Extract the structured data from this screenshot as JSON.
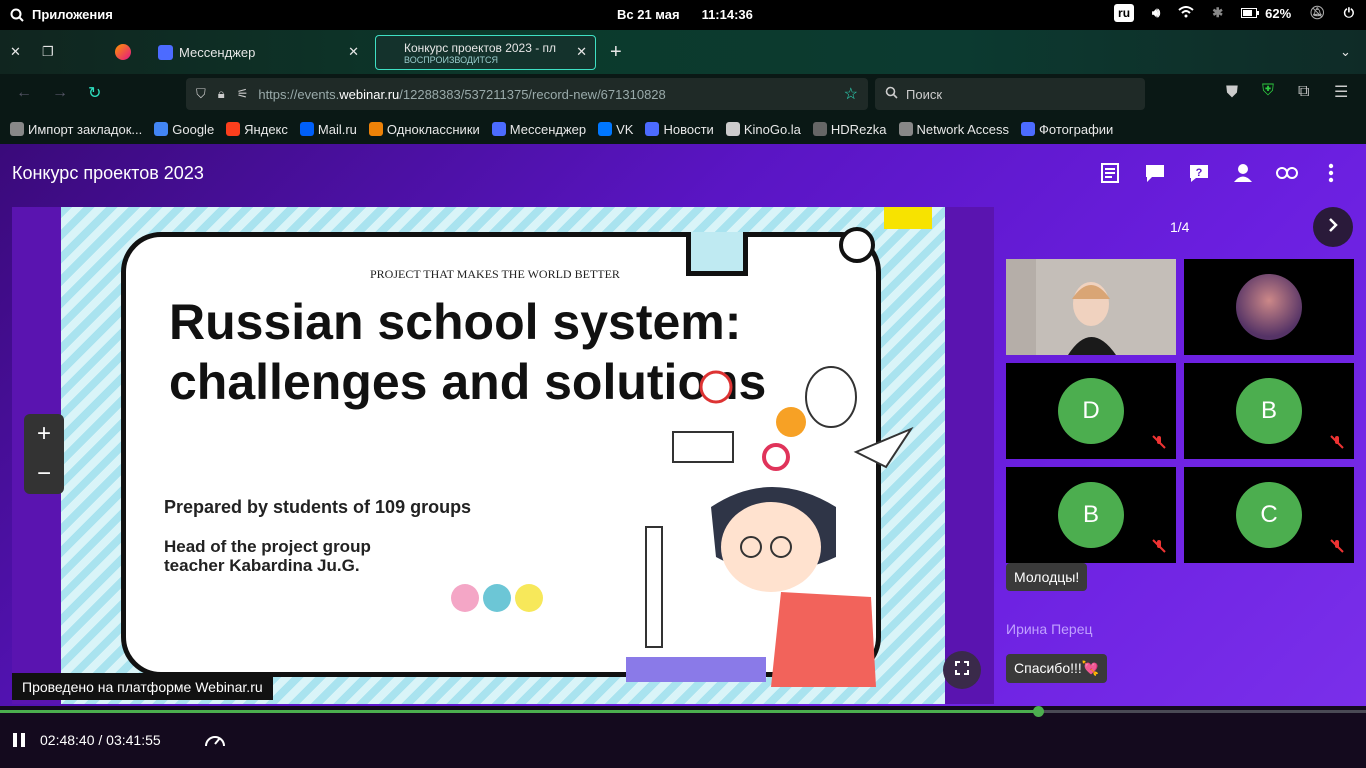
{
  "system": {
    "apps_label": "Приложения",
    "date": "Вс 21 мая",
    "time": "11:14:36",
    "lang": "ru",
    "battery": "62%"
  },
  "tabs": [
    {
      "label": "Мессенджер"
    },
    {
      "label": "Конкурс проектов 2023 - пл",
      "sublabel": "ВОСПРОИЗВОДИТСЯ"
    }
  ],
  "address": {
    "prefix": "https://events.",
    "host": "webinar.ru",
    "path": "/12288383/537211375/record-new/671310828"
  },
  "search": {
    "placeholder": "Поиск"
  },
  "bookmarks": [
    {
      "label": "Импорт закладок...",
      "color": "#888888"
    },
    {
      "label": "Google",
      "color": "#4285f4"
    },
    {
      "label": "Яндекс",
      "color": "#fc3f1d"
    },
    {
      "label": "Mail.ru",
      "color": "#005ff9"
    },
    {
      "label": "Одноклассники",
      "color": "#ee8208"
    },
    {
      "label": "Мессенджер",
      "color": "#4c6bff"
    },
    {
      "label": "VK",
      "color": "#0077ff"
    },
    {
      "label": "Новости",
      "color": "#4c6bff"
    },
    {
      "label": "KinoGo.la",
      "color": "#cccccc"
    },
    {
      "label": "HDRezka",
      "color": "#666666"
    },
    {
      "label": "Network Access",
      "color": "#888888"
    },
    {
      "label": "Фотографии",
      "color": "#4c6bff"
    }
  ],
  "webinar": {
    "title": "Конкурс проектов 2023",
    "page": "1/4",
    "credit": "Проведено на платформе Webinar.ru"
  },
  "slide": {
    "subtitle": "PROJECT THAT MAKES THE WORLD BETTER",
    "title": "Russian school system: challenges and solutions",
    "prepared": "Prepared by students of 109 groups",
    "head1": "Head of the project group",
    "head2": "teacher Kabardina Ju.G."
  },
  "participants": [
    {
      "initial": "",
      "kind": "video"
    },
    {
      "initial": "",
      "kind": "photo"
    },
    {
      "initial": "D",
      "kind": "avatar"
    },
    {
      "initial": "B",
      "kind": "avatar"
    },
    {
      "initial": "B",
      "kind": "avatar"
    },
    {
      "initial": "C",
      "kind": "avatar"
    }
  ],
  "chat": {
    "msg1": "Молодцы!",
    "author": "Ирина Перец",
    "msg2": "Спасибо!!!💘"
  },
  "player": {
    "time": "02:48:40 / 03:41:55",
    "progress": 0.76
  },
  "colors": {
    "accent": "#4cae4f",
    "purple": "#6b1fe0"
  }
}
